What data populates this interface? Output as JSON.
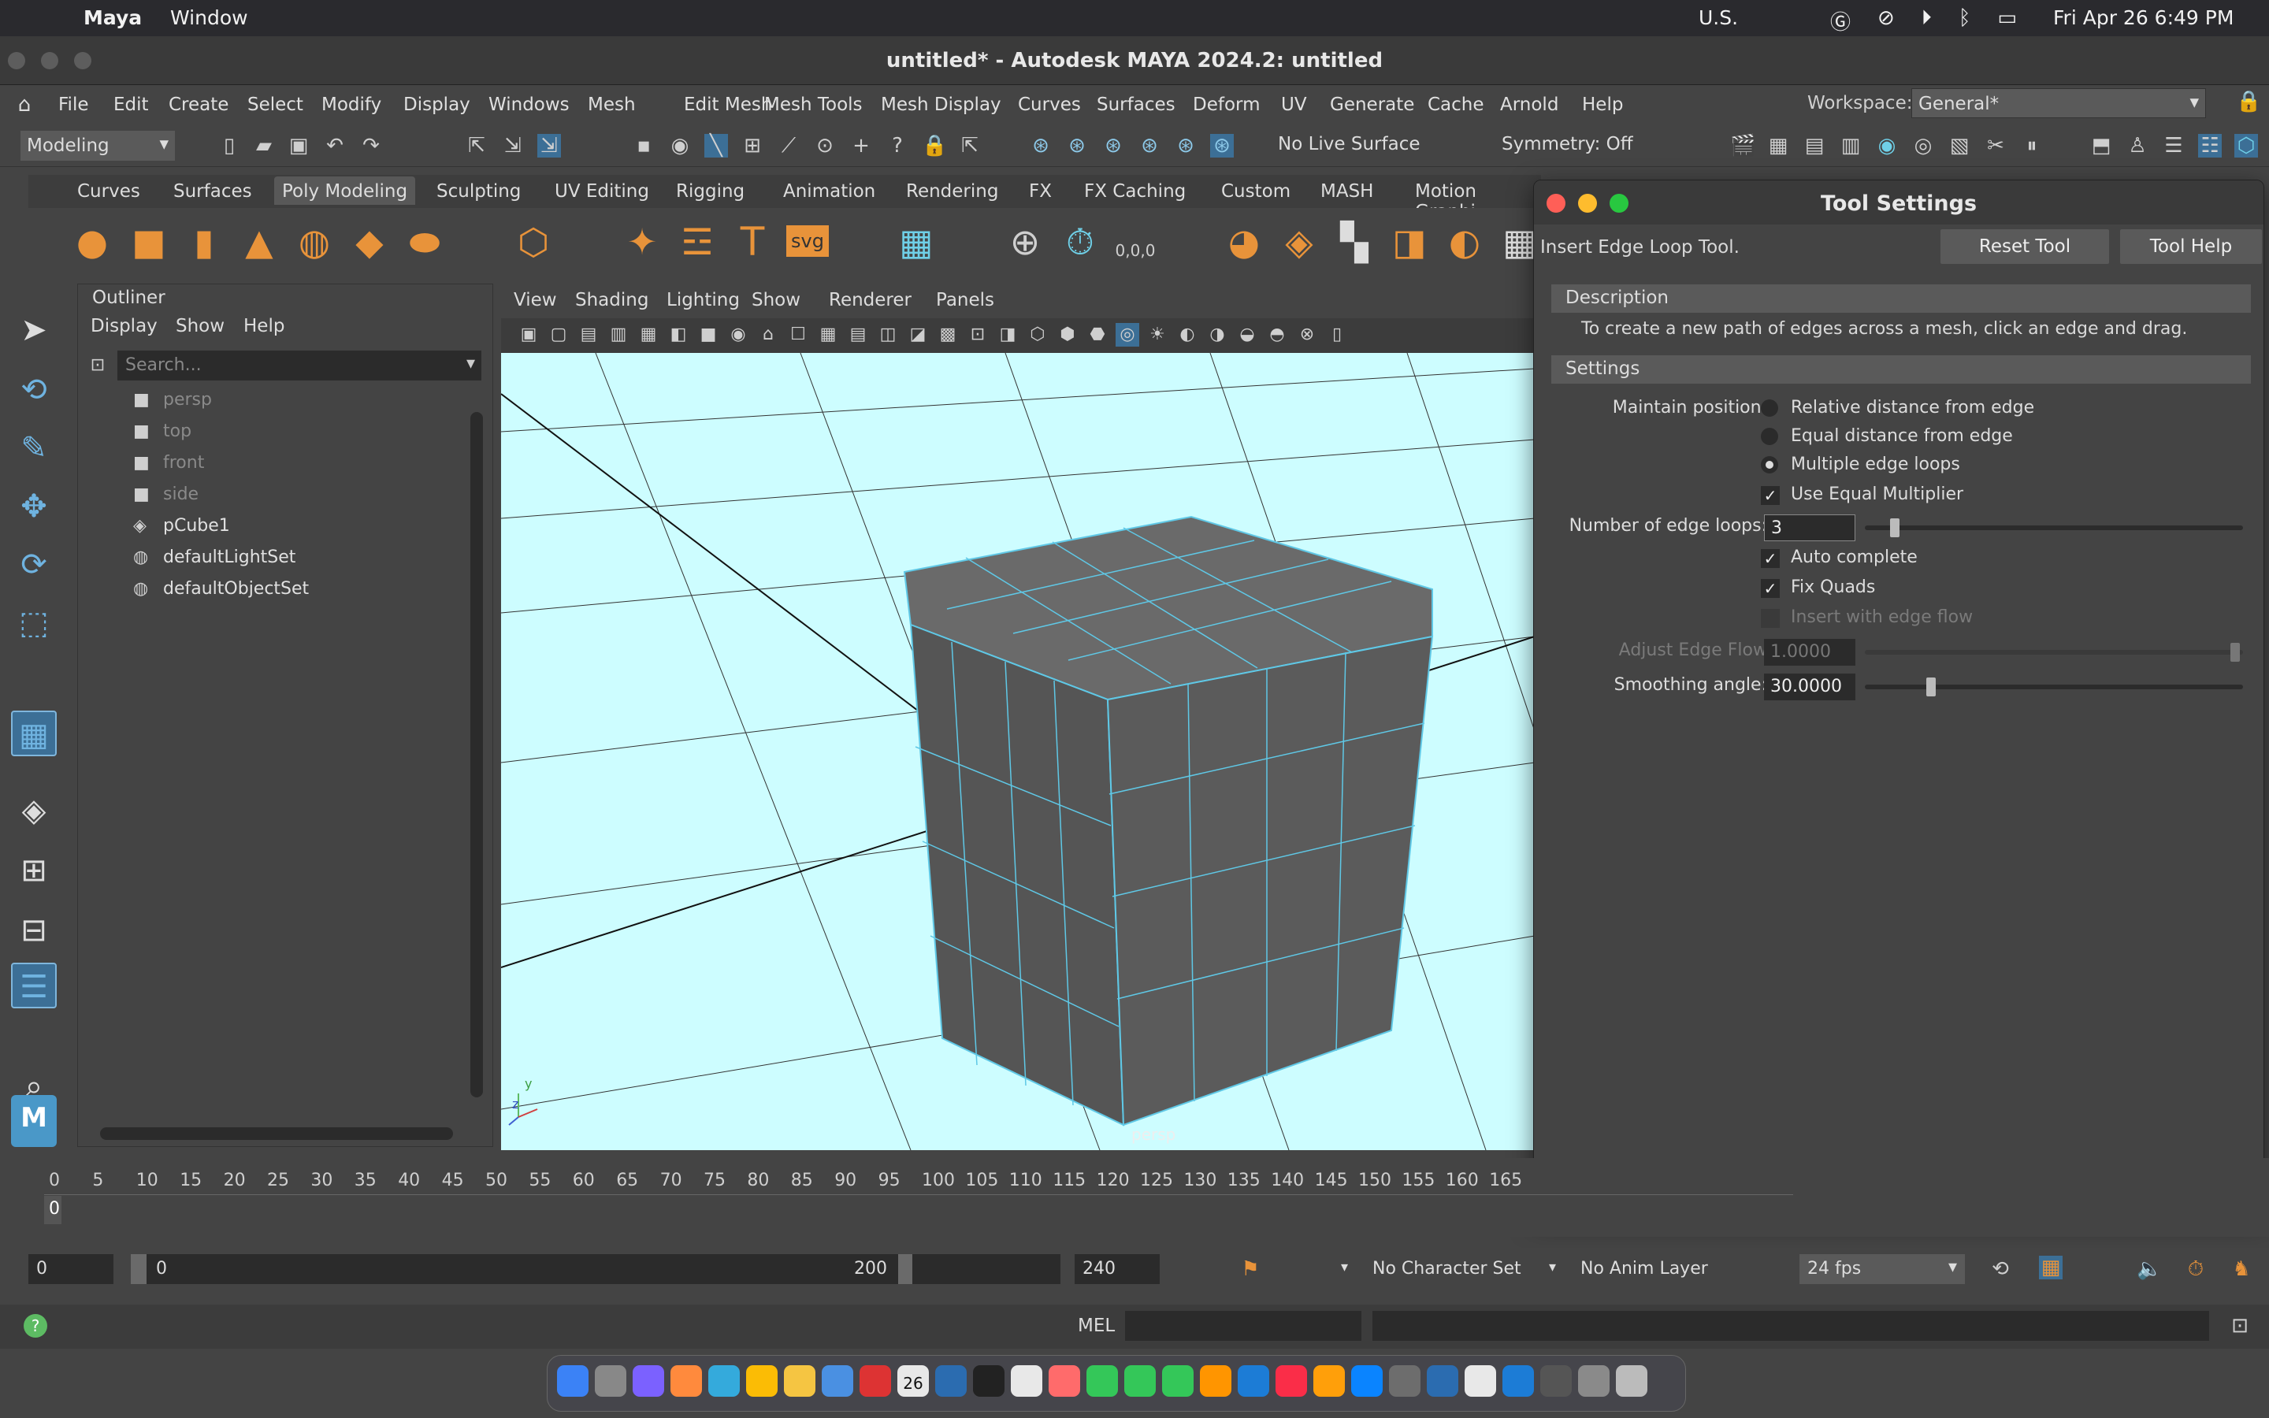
{
  "macos": {
    "app_name": "Maya",
    "menu_window": "Window",
    "input_source": "U.S.",
    "clock": "Fri Apr 26  6:49 PM"
  },
  "window": {
    "title": "untitled* - Autodesk MAYA 2024.2: untitled"
  },
  "main_menu": [
    "File",
    "Edit",
    "Create",
    "Select",
    "Modify",
    "Display",
    "Windows",
    "Mesh",
    "Edit Mesh",
    "Mesh Tools",
    "Mesh Display",
    "Curves",
    "Surfaces",
    "Deform",
    "UV",
    "Generate",
    "Cache",
    "Arnold",
    "Help"
  ],
  "workspace": {
    "label": "Workspace:",
    "value": "General*"
  },
  "status_line": {
    "mode": "Modeling",
    "live_surface": "No Live Surface",
    "symmetry": "Symmetry: Off"
  },
  "shelf_tabs": [
    "Curves",
    "Surfaces",
    "Poly Modeling",
    "Sculpting",
    "UV Editing",
    "Rigging",
    "Animation",
    "Rendering",
    "FX",
    "FX Caching",
    "Custom",
    "MASH",
    "Motion Graphi"
  ],
  "shelf_active": "Poly Modeling",
  "shelf_text_icons": {
    "text": "T",
    "svg": "svg",
    "coords": "0,0,0"
  },
  "outliner": {
    "title": "Outliner",
    "menus": [
      "Display",
      "Show",
      "Help"
    ],
    "search_placeholder": "Search...",
    "items": [
      {
        "name": "persp",
        "dim": true
      },
      {
        "name": "top",
        "dim": true
      },
      {
        "name": "front",
        "dim": true
      },
      {
        "name": "side",
        "dim": true
      },
      {
        "name": "pCube1",
        "dim": false
      },
      {
        "name": "defaultLightSet",
        "dim": false
      },
      {
        "name": "defaultObjectSet",
        "dim": false
      }
    ]
  },
  "viewport": {
    "menus": [
      "View",
      "Shading",
      "Lighting",
      "Show",
      "Renderer",
      "Panels"
    ],
    "camera_label": "persp",
    "axis_y": "y",
    "axis_z": "z"
  },
  "tool_settings": {
    "title": "Tool Settings",
    "tool_name": "Insert Edge Loop Tool.",
    "reset_button": "Reset Tool",
    "help_button": "Tool Help",
    "description_header": "Description",
    "description": "To create a new path of edges across a mesh, click an edge and drag.",
    "settings_header": "Settings",
    "maintain_position_label": "Maintain position:",
    "radio_options": [
      "Relative distance from edge",
      "Equal distance from edge",
      "Multiple edge loops"
    ],
    "radio_selected": 2,
    "use_equal_multiplier": "Use Equal Multiplier",
    "num_loops_label": "Number of edge loops:",
    "num_loops_value": "3",
    "auto_complete": "Auto complete",
    "fix_quads": "Fix Quads",
    "insert_with_edge_flow": "Insert with edge flow",
    "adjust_edge_flow_label": "Adjust Edge Flow",
    "adjust_edge_flow_value": "1.0000",
    "smoothing_angle_label": "Smoothing angle:",
    "smoothing_angle_value": "30.0000"
  },
  "timeline": {
    "ticks": [
      "0",
      "5",
      "10",
      "15",
      "20",
      "25",
      "30",
      "35",
      "40",
      "45",
      "50",
      "55",
      "60",
      "65",
      "70",
      "75",
      "80",
      "85",
      "90",
      "95",
      "100",
      "105",
      "110",
      "115",
      "120",
      "125",
      "130",
      "135",
      "140",
      "145",
      "150",
      "155",
      "160",
      "165"
    ],
    "current": "0"
  },
  "range": {
    "start": "0",
    "inner_start": "0",
    "inner_end": "200",
    "end": "240",
    "character_set": "No Character Set",
    "anim_layer": "No Anim Layer",
    "fps": "24 fps"
  },
  "command_line": {
    "lang": "MEL"
  },
  "dock": {
    "calendar_day": "26"
  },
  "colors": {
    "accent": "#5fc8e6",
    "viewport_bg": "#cdfdff",
    "shelf_orange": "#e8933a",
    "ui_bg": "#444444"
  }
}
